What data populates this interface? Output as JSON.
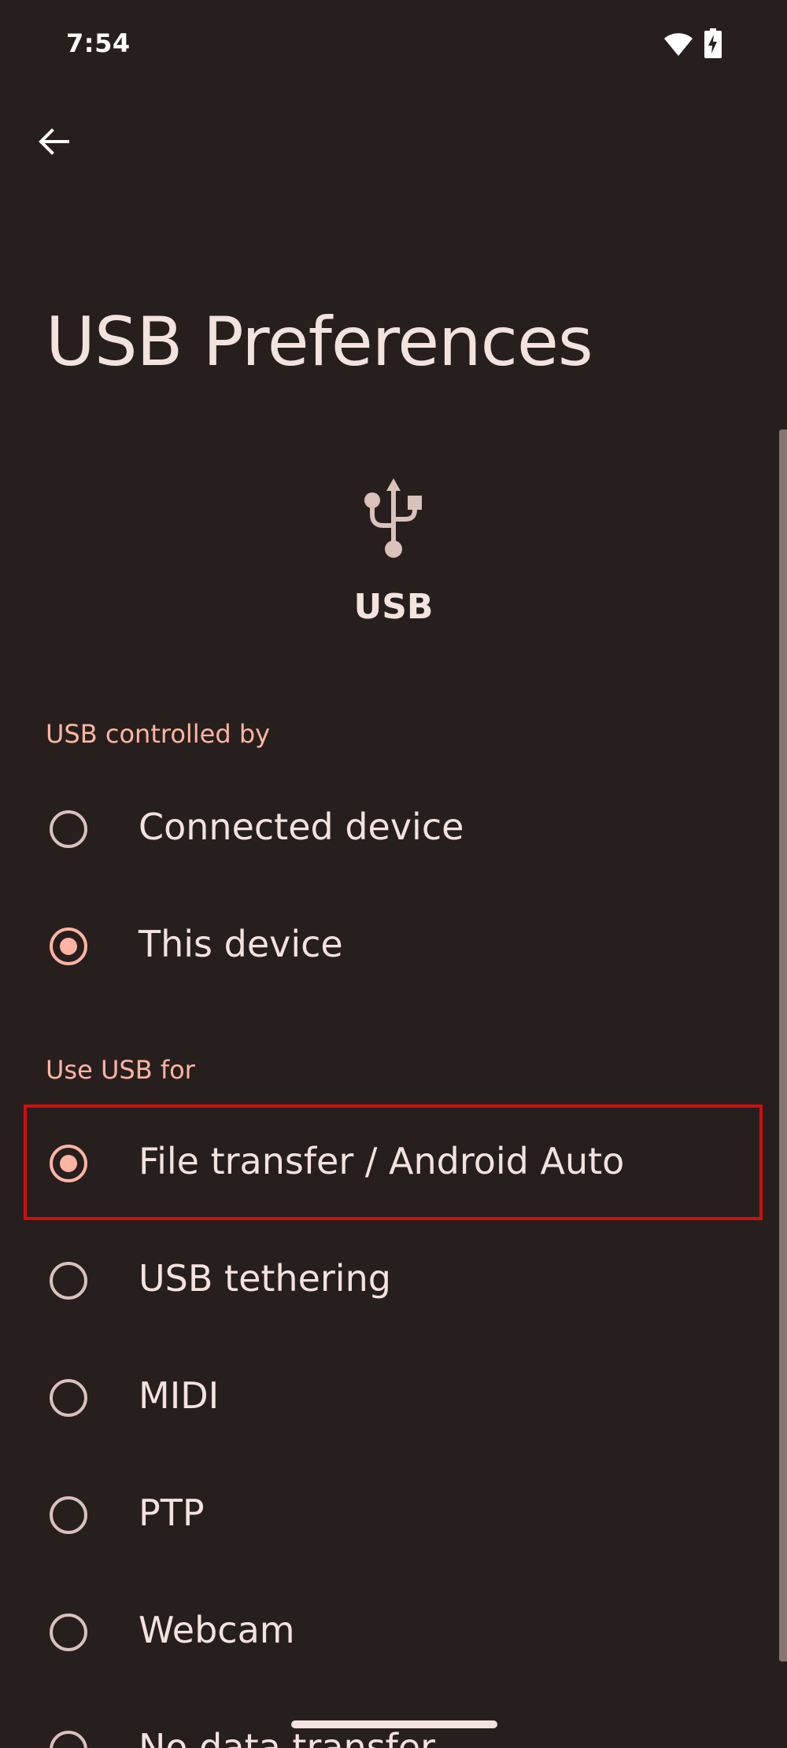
{
  "status_bar": {
    "time": "7:54"
  },
  "header": {
    "title": "USB Preferences"
  },
  "usb_header": {
    "label": "USB"
  },
  "sections": {
    "controlled_by": {
      "title": "USB controlled by",
      "options": [
        {
          "label": "Connected device",
          "selected": false
        },
        {
          "label": "This device",
          "selected": true
        }
      ]
    },
    "use_for": {
      "title": "Use USB for",
      "options": [
        {
          "label": "File transfer / Android Auto",
          "selected": true
        },
        {
          "label": "USB tethering",
          "selected": false
        },
        {
          "label": "MIDI",
          "selected": false
        },
        {
          "label": "PTP",
          "selected": false
        },
        {
          "label": "Webcam",
          "selected": false
        },
        {
          "label": "No data transfer",
          "selected": false
        }
      ]
    }
  },
  "colors": {
    "background": "#271f1e",
    "accent": "#ffb4a3",
    "text": "#f4e2de",
    "radio_unchecked": "#dac1bc",
    "highlight": "#d40d0d"
  }
}
